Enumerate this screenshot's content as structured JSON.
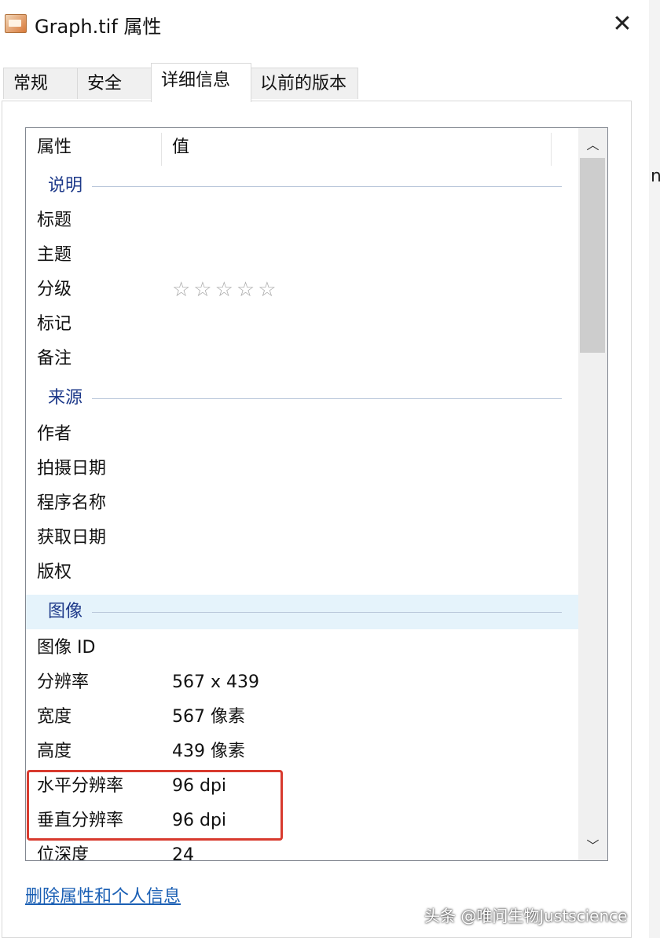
{
  "window": {
    "title": "Graph.tif 属性",
    "close_glyph": "✕"
  },
  "tabs": [
    {
      "label": "常规",
      "active": false
    },
    {
      "label": "安全",
      "active": false
    },
    {
      "label": "详细信息",
      "active": true
    },
    {
      "label": "以前的版本",
      "active": false
    }
  ],
  "columns": {
    "property": "属性",
    "value": "值"
  },
  "groups": {
    "description": {
      "label": "说明"
    },
    "origin": {
      "label": "来源"
    },
    "image": {
      "label": "图像"
    }
  },
  "rows": {
    "title": {
      "name": "标题",
      "value": ""
    },
    "subject": {
      "name": "主题",
      "value": ""
    },
    "rating": {
      "name": "分级",
      "value": "☆☆☆☆☆"
    },
    "tags": {
      "name": "标记",
      "value": ""
    },
    "comments": {
      "name": "备注",
      "value": ""
    },
    "author": {
      "name": "作者",
      "value": ""
    },
    "date_taken": {
      "name": "拍摄日期",
      "value": ""
    },
    "program_name": {
      "name": "程序名称",
      "value": ""
    },
    "date_acquired": {
      "name": "获取日期",
      "value": ""
    },
    "copyright": {
      "name": "版权",
      "value": ""
    },
    "image_id": {
      "name": "图像 ID",
      "value": ""
    },
    "dimensions": {
      "name": "分辨率",
      "value": "567 x 439"
    },
    "width": {
      "name": "宽度",
      "value": "567 像素"
    },
    "height": {
      "name": "高度",
      "value": "439 像素"
    },
    "h_resolution": {
      "name": "水平分辨率",
      "value": "96 dpi"
    },
    "v_resolution": {
      "name": "垂直分辨率",
      "value": "96 dpi"
    },
    "bit_depth": {
      "name": "位深度",
      "value": "24"
    }
  },
  "scrollbar": {
    "up_glyph": "︿",
    "down_glyph": "﹀"
  },
  "links": {
    "remove_properties": "删除属性和个人信息"
  },
  "overlay": {
    "watermark": "头条 @唯问生物Justscience"
  },
  "right_edge_fragment": "n",
  "colors": {
    "highlight_box": "#d83a2e",
    "link": "#1a5fb4",
    "group_text": "#1e3a8a",
    "selected_group": "#e5f3fb"
  }
}
